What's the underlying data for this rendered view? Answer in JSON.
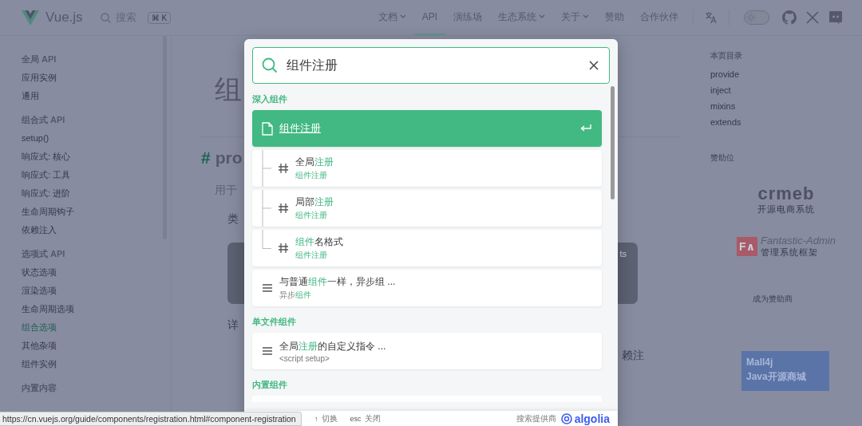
{
  "header": {
    "logo": "Vue.js",
    "search": {
      "label": "搜索",
      "shortcut": "⌘ K"
    },
    "nav": [
      {
        "label": "文档",
        "dropdown": true,
        "selected": false
      },
      {
        "label": "API",
        "dropdown": false,
        "selected": true
      },
      {
        "label": "演练场",
        "dropdown": false,
        "selected": false
      },
      {
        "label": "生态系统",
        "dropdown": true,
        "selected": false
      },
      {
        "label": "关于",
        "dropdown": true,
        "selected": false
      },
      {
        "label": "赞助",
        "dropdown": false,
        "selected": false
      },
      {
        "label": "合作伙伴",
        "dropdown": false,
        "selected": false
      }
    ],
    "theme_switch": {
      "on": false
    }
  },
  "sidebar": {
    "groups": [
      {
        "title": "全局 API",
        "items": [
          {
            "label": "应用实例",
            "selected": false
          },
          {
            "label": "通用",
            "selected": false
          }
        ]
      },
      {
        "title": "组合式 API",
        "items": [
          {
            "label": "setup()",
            "selected": false
          },
          {
            "label": "响应式: 核心",
            "selected": false
          },
          {
            "label": "响应式: 工具",
            "selected": false
          },
          {
            "label": "响应式: 进阶",
            "selected": false
          },
          {
            "label": "生命周期钩子",
            "selected": false
          },
          {
            "label": "依赖注入",
            "selected": false
          }
        ]
      },
      {
        "title": "选项式 API",
        "items": [
          {
            "label": "状态选项",
            "selected": false
          },
          {
            "label": "渲染选项",
            "selected": false
          },
          {
            "label": "生命周期选项",
            "selected": false
          },
          {
            "label": "组合选项",
            "selected": true
          },
          {
            "label": "其他杂项",
            "selected": false
          },
          {
            "label": "组件实例",
            "selected": false
          }
        ]
      },
      {
        "title": "内置内容"
      }
    ]
  },
  "content": {
    "title": "组",
    "anchor": "#",
    "heading": "pro",
    "intro": "用于",
    "bullets": [
      "类",
      "详"
    ],
    "code": {
      "lang": "ts"
    },
    "trailing": "赖注"
  },
  "toc": {
    "title": "本页目录",
    "items": [
      "provide",
      "inject",
      "mixins",
      "extends"
    ]
  },
  "sponsors": {
    "title": "赞助位",
    "logos": [
      {
        "kind": "crmeb",
        "name": "crmeb",
        "tagline": "开源电商系统"
      },
      {
        "kind": "fantastic",
        "mark": "F∧",
        "name": "Fantastic-Admin",
        "tagline": "管理系统框架"
      }
    ],
    "cta": "成为赞助商",
    "banner": {
      "line1": "Mall4j",
      "line2": "Java开源商城"
    }
  },
  "search_modal": {
    "query": "组件注册",
    "sections": [
      {
        "title": "深入组件",
        "hits": [
          {
            "kind": "page",
            "selected": true,
            "title": [
              {
                "text": "组件注册",
                "hit": false
              }
            ]
          },
          {
            "kind": "heading",
            "tree_last": false,
            "selected": false,
            "title": [
              {
                "text": "全局",
                "hit": false
              },
              {
                "text": "注册",
                "hit": true
              }
            ],
            "sub": [
              {
                "text": "组件注册",
                "hit": true
              }
            ]
          },
          {
            "kind": "heading",
            "tree_last": false,
            "selected": false,
            "title": [
              {
                "text": "局部",
                "hit": false
              },
              {
                "text": "注册",
                "hit": true
              }
            ],
            "sub": [
              {
                "text": "组件注册",
                "hit": true
              }
            ]
          },
          {
            "kind": "heading",
            "tree_last": true,
            "selected": false,
            "title": [
              {
                "text": "组件",
                "hit": true
              },
              {
                "text": "名格式",
                "hit": false
              }
            ],
            "sub": [
              {
                "text": "组件注册",
                "hit": true
              }
            ]
          },
          {
            "kind": "text",
            "selected": false,
            "title": [
              {
                "text": "与普通",
                "hit": false
              },
              {
                "text": "组件",
                "hit": true
              },
              {
                "text": "一样，异步组 ...",
                "hit": false
              }
            ],
            "sub": [
              {
                "text": "异步",
                "hit": false
              },
              {
                "text": "组件",
                "hit": true
              }
            ]
          }
        ]
      },
      {
        "title": "单文件组件",
        "hits": [
          {
            "kind": "text",
            "selected": false,
            "title": [
              {
                "text": "全局",
                "hit": false
              },
              {
                "text": "注册",
                "hit": true
              },
              {
                "text": "的自定义指令 ...",
                "hit": false
              }
            ],
            "sub": [
              {
                "text": "<script setup>",
                "hit": false
              }
            ]
          }
        ]
      },
      {
        "title": "内置组件"
      }
    ],
    "footer": {
      "keys": [
        {
          "key": "↑",
          "label": "切换"
        },
        {
          "key": "esc",
          "label": "关闭"
        }
      ],
      "provider": "搜索提供商",
      "brand": "algolia"
    }
  },
  "status_url": "https://cn.vuejs.org/guide/components/registration.html#component-registration"
}
